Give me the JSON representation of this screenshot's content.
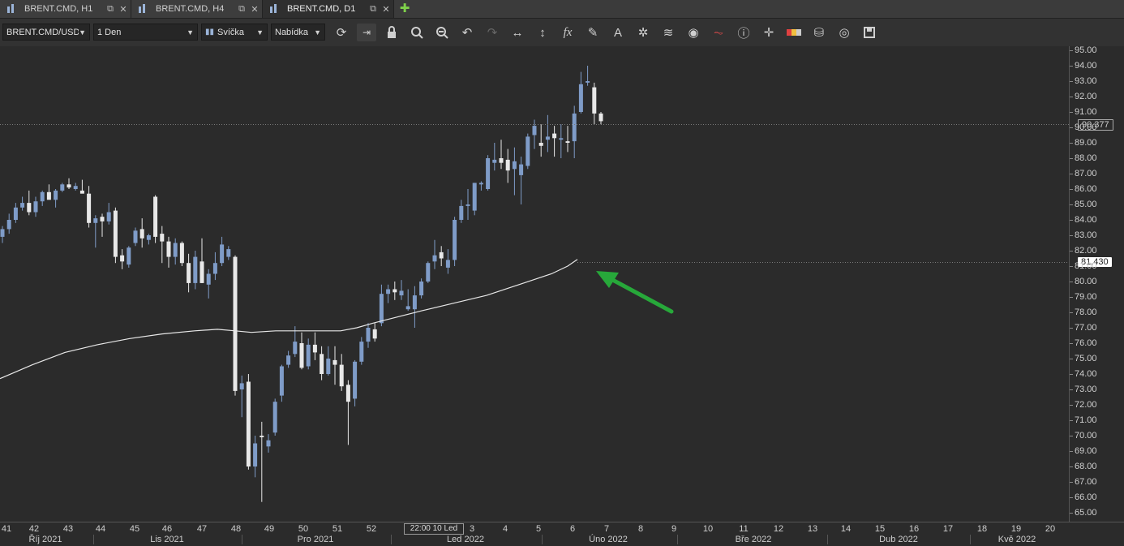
{
  "tabs": [
    {
      "label": "BRENT.CMD, H1",
      "active": false
    },
    {
      "label": "BRENT.CMD, H4",
      "active": false
    },
    {
      "label": "BRENT.CMD, D1",
      "active": true
    }
  ],
  "toolbar": {
    "instrument": "BRENT.CMD/USD",
    "period": "1 Den",
    "chart_type": "Svíčka",
    "menu": "Nabídka",
    "icons": [
      "refresh-icon",
      "shift-chart-icon",
      "lock-icon",
      "zoom-in-icon",
      "zoom-out-icon",
      "undo-icon",
      "redo-icon",
      "horizontal-scale-icon",
      "vertical-scale-icon",
      "fx-indicators-icon",
      "pencil-draw-icon",
      "text-tool-icon",
      "crosshair-star-icon",
      "layers-icon",
      "eye-icon",
      "signals-icon",
      "info-icon",
      "cursor-icon",
      "color-bar-icon",
      "paint-bucket-icon",
      "refresh-circle-icon",
      "save-icon"
    ]
  },
  "price_axis": {
    "ticks": [
      "95.00",
      "94.00",
      "93.00",
      "92.00",
      "91.00",
      "90.00",
      "89.00",
      "88.00",
      "87.00",
      "86.00",
      "85.00",
      "84.00",
      "83.00",
      "82.00",
      "81.00",
      "80.00",
      "79.00",
      "78.00",
      "77.00",
      "76.00",
      "75.00",
      "74.00",
      "73.00",
      "72.00",
      "71.00",
      "70.00",
      "69.00",
      "68.00",
      "67.00",
      "66.00",
      "65.00"
    ],
    "current_price_label": "90.377",
    "ma_label": "81.430"
  },
  "time_axis": {
    "weeks": [
      "41",
      "42",
      "43",
      "44",
      "45",
      "46",
      "47",
      "48",
      "49",
      "50",
      "51",
      "52",
      "3",
      "4",
      "5",
      "6",
      "7",
      "8",
      "9",
      "10",
      "11",
      "12",
      "13",
      "14",
      "15",
      "16",
      "17",
      "18",
      "19",
      "20"
    ],
    "cursor_label": "22:00 10 Led",
    "months": [
      "Říj 2021",
      "Lis 2021",
      "Pro 2021",
      "Led 2022",
      "Úno 2022",
      "Bře 2022",
      "Dub 2022",
      "Kvě 2022"
    ]
  },
  "colors": {
    "background": "#2b2b2b",
    "bull_candle": "#7f9cc8",
    "bear_candle": "#e8e8e8",
    "moving_average": "#e8e8e8",
    "arrow": "#27a83a"
  },
  "chart_data": {
    "type": "candlestick",
    "title": "BRENT.CMD, D1",
    "ylim": [
      65,
      95
    ],
    "ylabel": "",
    "xlabel": "",
    "candles": [
      [
        82.9,
        83.6,
        82.5,
        83.4
      ],
      [
        83.4,
        84.4,
        83.1,
        84.0
      ],
      [
        84.0,
        85.1,
        83.8,
        84.8
      ],
      [
        84.8,
        85.5,
        84.6,
        85.1
      ],
      [
        85.1,
        85.9,
        84.3,
        84.5
      ],
      [
        84.5,
        85.5,
        84.2,
        85.2
      ],
      [
        85.2,
        85.9,
        84.9,
        85.8
      ],
      [
        85.8,
        86.3,
        85.4,
        85.3
      ],
      [
        85.3,
        86.0,
        84.8,
        85.9
      ],
      [
        85.9,
        86.4,
        85.8,
        86.3
      ],
      [
        86.3,
        86.7,
        86.0,
        86.1
      ],
      [
        86.0,
        86.4,
        85.9,
        86.2
      ],
      [
        85.9,
        86.6,
        85.8,
        85.7
      ],
      [
        85.7,
        86.2,
        83.5,
        83.8
      ],
      [
        83.8,
        84.3,
        82.2,
        84.1
      ],
      [
        84.2,
        84.4,
        82.9,
        83.9
      ],
      [
        83.9,
        85.1,
        83.7,
        84.5
      ],
      [
        84.6,
        84.8,
        81.2,
        81.6
      ],
      [
        81.7,
        82.1,
        80.8,
        81.3
      ],
      [
        81.1,
        82.3,
        80.9,
        82.2
      ],
      [
        82.5,
        83.5,
        82.3,
        83.3
      ],
      [
        83.4,
        84.1,
        82.2,
        82.8
      ],
      [
        82.7,
        83.1,
        82.4,
        83.0
      ],
      [
        85.5,
        85.6,
        82.5,
        82.9
      ],
      [
        83.1,
        83.6,
        81.2,
        82.6
      ],
      [
        82.6,
        82.9,
        80.9,
        81.6
      ],
      [
        81.6,
        82.8,
        81.1,
        82.5
      ],
      [
        82.5,
        82.6,
        81.0,
        81.2
      ],
      [
        81.2,
        81.8,
        79.3,
        79.9
      ],
      [
        79.9,
        82.0,
        79.5,
        81.6
      ],
      [
        81.3,
        82.8,
        79.9,
        79.9
      ],
      [
        79.8,
        80.8,
        78.9,
        80.5
      ],
      [
        80.5,
        81.9,
        80.1,
        81.2
      ],
      [
        81.2,
        82.9,
        81.0,
        82.4
      ],
      [
        81.6,
        82.3,
        81.4,
        82.1
      ],
      [
        81.6,
        81.7,
        72.6,
        72.9
      ],
      [
        73.0,
        73.9,
        71.2,
        73.4
      ],
      [
        73.5,
        74.0,
        67.8,
        68.0
      ],
      [
        68.0,
        70.0,
        67.3,
        69.5
      ],
      [
        70.0,
        70.9,
        65.7,
        69.9
      ],
      [
        69.3,
        70.1,
        68.9,
        69.7
      ],
      [
        70.2,
        72.4,
        70.0,
        72.2
      ],
      [
        72.6,
        74.6,
        72.2,
        74.5
      ],
      [
        74.6,
        75.5,
        74.4,
        75.2
      ],
      [
        75.3,
        77.1,
        75.1,
        76.1
      ],
      [
        76.0,
        76.7,
        74.3,
        74.4
      ],
      [
        74.5,
        76.3,
        74.3,
        75.9
      ],
      [
        75.9,
        76.7,
        74.9,
        75.4
      ],
      [
        75.3,
        75.8,
        73.6,
        74.0
      ],
      [
        74.0,
        75.8,
        73.9,
        75.0
      ],
      [
        74.9,
        75.8,
        73.3,
        74.6
      ],
      [
        74.6,
        75.3,
        72.9,
        73.2
      ],
      [
        73.3,
        73.6,
        69.4,
        72.2
      ],
      [
        72.4,
        74.9,
        71.9,
        74.8
      ],
      [
        74.8,
        76.4,
        74.6,
        76.1
      ],
      [
        76.1,
        77.3,
        75.7,
        77.0
      ],
      [
        76.9,
        77.3,
        76.1,
        76.3
      ],
      [
        77.3,
        79.8,
        77.1,
        79.2
      ],
      [
        79.2,
        79.8,
        78.6,
        79.5
      ],
      [
        79.5,
        80.0,
        78.8,
        79.3
      ],
      [
        79.1,
        80.1,
        78.8,
        79.4
      ],
      [
        78.2,
        79.5,
        78.1,
        78.4
      ],
      [
        78.2,
        79.7,
        77.0,
        79.1
      ],
      [
        79.1,
        80.2,
        78.9,
        80.0
      ],
      [
        80.0,
        81.3,
        79.9,
        81.2
      ],
      [
        81.3,
        82.7,
        80.8,
        81.7
      ],
      [
        81.9,
        82.3,
        81.0,
        81.5
      ],
      [
        80.9,
        82.1,
        80.5,
        81.4
      ],
      [
        81.4,
        84.2,
        81.0,
        84.0
      ],
      [
        84.0,
        85.3,
        83.8,
        84.9
      ],
      [
        84.9,
        86.0,
        84.0,
        85.0
      ],
      [
        84.6,
        86.4,
        84.3,
        86.4
      ],
      [
        86.3,
        86.5,
        85.9,
        86.4
      ],
      [
        86.0,
        88.2,
        85.9,
        88.0
      ],
      [
        87.7,
        89.0,
        87.2,
        87.9
      ],
      [
        88.0,
        89.2,
        87.3,
        87.7
      ],
      [
        87.9,
        88.6,
        86.4,
        87.2
      ],
      [
        87.3,
        88.7,
        85.6,
        87.8
      ],
      [
        86.9,
        88.1,
        85.0,
        87.6
      ],
      [
        87.5,
        89.6,
        87.3,
        89.4
      ],
      [
        89.5,
        90.5,
        88.6,
        90.1
      ],
      [
        89.0,
        90.2,
        88.1,
        88.8
      ],
      [
        89.2,
        90.8,
        88.4,
        89.4
      ],
      [
        89.6,
        90.1,
        88.1,
        89.3
      ],
      [
        89.2,
        90.2,
        88.0,
        89.3
      ],
      [
        89.1,
        90.1,
        88.4,
        89.0
      ],
      [
        89.1,
        91.4,
        88.0,
        90.9
      ],
      [
        91.0,
        93.6,
        90.9,
        92.8
      ],
      [
        92.9,
        94.0,
        92.7,
        93.0
      ],
      [
        92.6,
        92.9,
        90.2,
        90.9
      ],
      [
        90.9,
        91.0,
        90.2,
        90.4
      ]
    ],
    "moving_average": [
      [
        0,
        73.7
      ],
      [
        40,
        74.6
      ],
      [
        80,
        75.4
      ],
      [
        120,
        75.9
      ],
      [
        160,
        76.3
      ],
      [
        200,
        76.6
      ],
      [
        240,
        76.8
      ],
      [
        268,
        76.9
      ],
      [
        290,
        76.8
      ],
      [
        310,
        76.7
      ],
      [
        340,
        76.8
      ],
      [
        380,
        76.8
      ],
      [
        420,
        76.8
      ],
      [
        440,
        77.0
      ],
      [
        460,
        77.3
      ],
      [
        490,
        77.7
      ],
      [
        520,
        78.1
      ],
      [
        560,
        78.6
      ],
      [
        600,
        79.1
      ],
      [
        640,
        79.8
      ],
      [
        680,
        80.5
      ],
      [
        700,
        81.0
      ],
      [
        712,
        81.43
      ]
    ],
    "annotations": [
      {
        "type": "arrow",
        "label": ""
      }
    ]
  }
}
